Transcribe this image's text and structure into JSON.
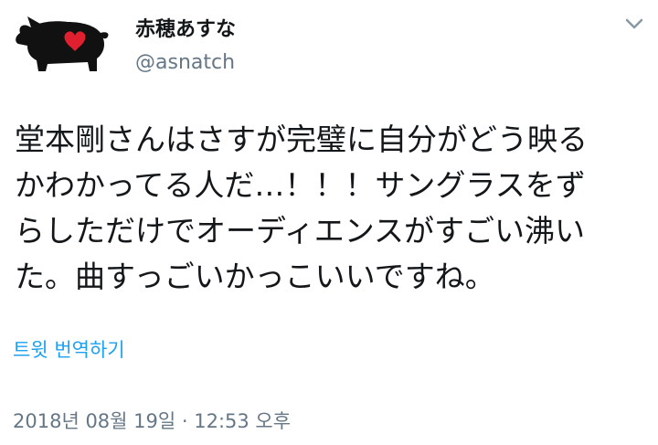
{
  "author": {
    "display_name": "赤穂あすな",
    "handle": "@asnatch",
    "avatar_icon": "pig-heart-icon"
  },
  "menu": {
    "caret_icon": "chevron-down-icon"
  },
  "tweet": {
    "text": "堂本剛さんはさすが完璧に自分がどう映る\nかわかってる人だ…！！！サングラスをず\nらしただけでオーディエンスがすごい沸い\nた。曲すっごいかっこいいですね。",
    "translate_label": "트윗 번역하기",
    "timestamp": "2018년 08월 19일 · 12:53 오후"
  },
  "colors": {
    "link": "#1da1f2",
    "muted": "#657786",
    "text": "#14171a",
    "heart": "#e0202e"
  }
}
